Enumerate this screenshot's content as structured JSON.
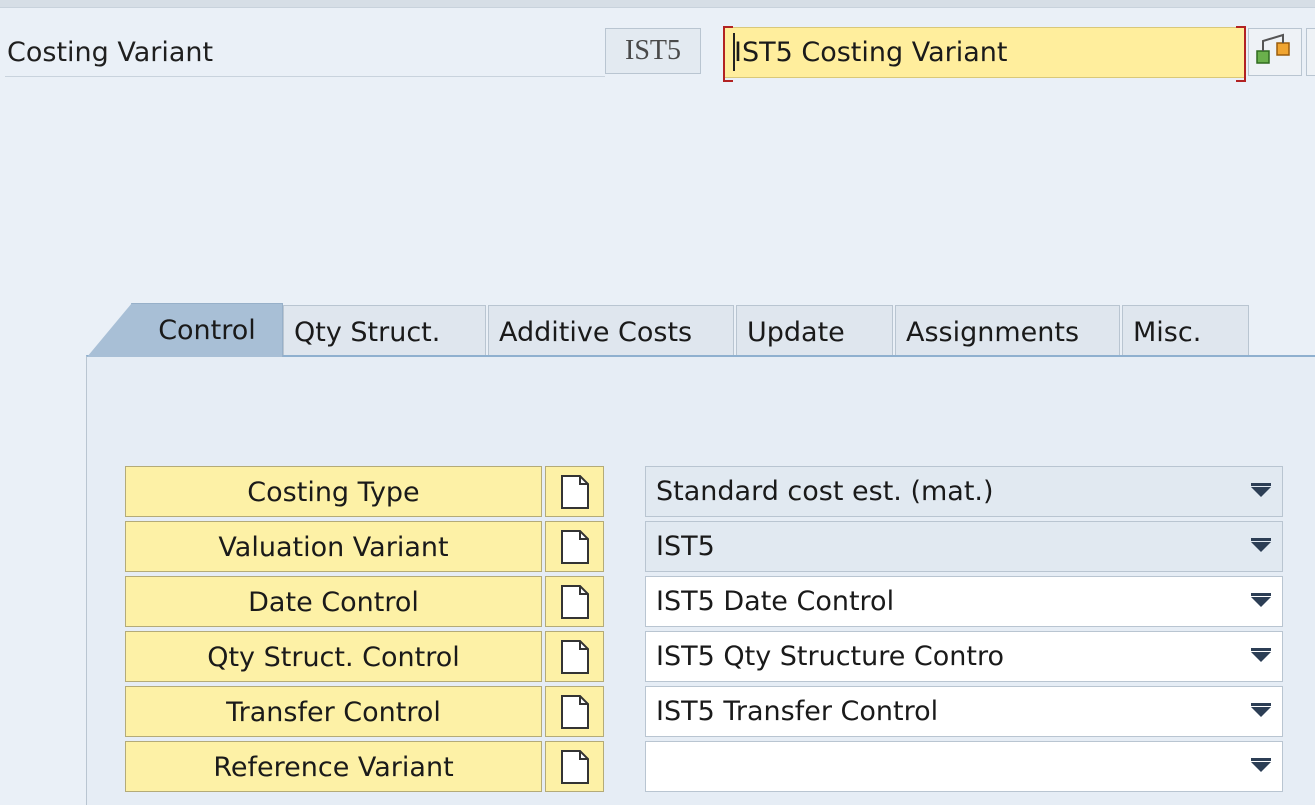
{
  "header": {
    "label": "Costing Variant",
    "code": "IST5",
    "description": "IST5 Costing Variant"
  },
  "tabs": [
    {
      "label": "Control",
      "active": true
    },
    {
      "label": "Qty Struct.",
      "active": false
    },
    {
      "label": "Additive Costs",
      "active": false
    },
    {
      "label": "Update",
      "active": false
    },
    {
      "label": "Assignments",
      "active": false
    },
    {
      "label": "Misc.",
      "active": false
    }
  ],
  "rows": [
    {
      "label": "Costing Type",
      "value": "Standard cost est. (mat.)",
      "readonly": true
    },
    {
      "label": "Valuation Variant",
      "value": "IST5",
      "readonly": true
    },
    {
      "label": "Date Control",
      "value": "IST5 Date Control",
      "readonly": false
    },
    {
      "label": "Qty Struct. Control",
      "value": "IST5 Qty Structure Contro",
      "readonly": false
    },
    {
      "label": "Transfer Control",
      "value": "IST5 Transfer Control",
      "readonly": false
    },
    {
      "label": "Reference Variant",
      "value": "",
      "readonly": false
    }
  ],
  "icons": {
    "hierarchy": "hierarchy-icon",
    "document": "document-icon",
    "dropdown": "chevron-down-icon"
  },
  "colors": {
    "background": "#eaf0f7",
    "input_highlight": "#ffee9d",
    "button_yellow": "#fdf1a6",
    "active_tab": "#a8bfd6"
  }
}
